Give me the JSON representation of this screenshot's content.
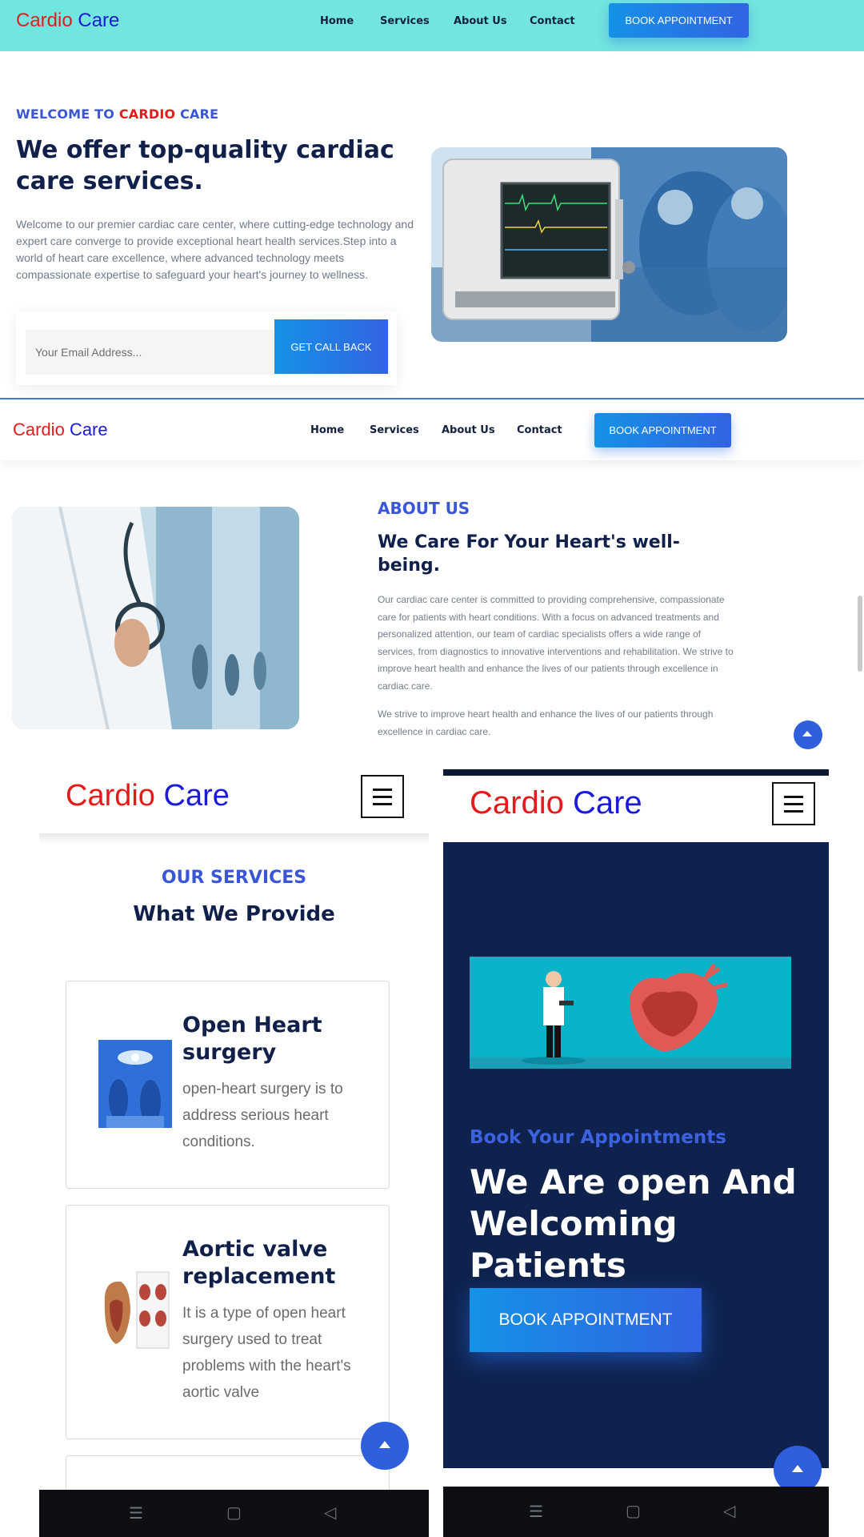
{
  "brand": {
    "part1": "Cardio",
    "part2": "Care",
    "red": "#e31b1b",
    "blue": "#1a1ad8"
  },
  "nav": {
    "home": "Home",
    "services": "Services",
    "about": "About Us",
    "contact": "Contact",
    "book_button": "BOOK APPOINTMENT",
    "menu_icon": "hamburger-menu-icon"
  },
  "hero": {
    "welcome_prefix": "WELCOME TO",
    "welcome_red": "CARDIO",
    "welcome_suffix": "CARE",
    "heading": "We offer top-quality cardiac care services.",
    "paragraph": "Welcome to our premier cardiac care center, where cutting-edge technology and expert care converge to provide exceptional heart health services.Step into a world of heart care excellence, where advanced technology meets compassionate expertise to safeguard your heart's journey to wellness.",
    "email_placeholder": "Your Email Address...",
    "call_button": "GET CALL BACK"
  },
  "about": {
    "tag": "ABOUT US",
    "heading": "We Care For Your Heart's well-being.",
    "paragraph1": "Our cardiac care center is committed to providing comprehensive, compassionate care for patients with heart conditions. With a focus on advanced treatments and personalized attention, our team of cardiac specialists offers a wide range of services, from diagnostics to innovative interventions and rehabilitation. We strive to improve heart health and enhance the lives of our patients through excellence in cardiac care.",
    "paragraph2": "We strive to improve heart health and enhance the lives of our patients through excellence in cardiac care."
  },
  "services": {
    "tag": "OUR SERVICES",
    "heading": "What We Provide",
    "items": [
      {
        "title": "Open Heart surgery",
        "desc": "open-heart surgery is to address serious heart conditions."
      },
      {
        "title": "Aortic valve replacement",
        "desc": "It is a type of open heart surgery used to treat problems with the heart's aortic valve"
      }
    ]
  },
  "appointment": {
    "tag": "Book Your Appointments",
    "heading": "We Are open And Welcoming Patients",
    "button": "BOOK APPOINTMENT"
  },
  "system_nav": {
    "recents_icon": "recents-icon",
    "home_icon": "home-square-icon",
    "back_icon": "back-triangle-icon"
  },
  "colors": {
    "accent": "#2f5fdc",
    "nav_teal": "#72e5df",
    "panel_navy": "#0f224d"
  }
}
